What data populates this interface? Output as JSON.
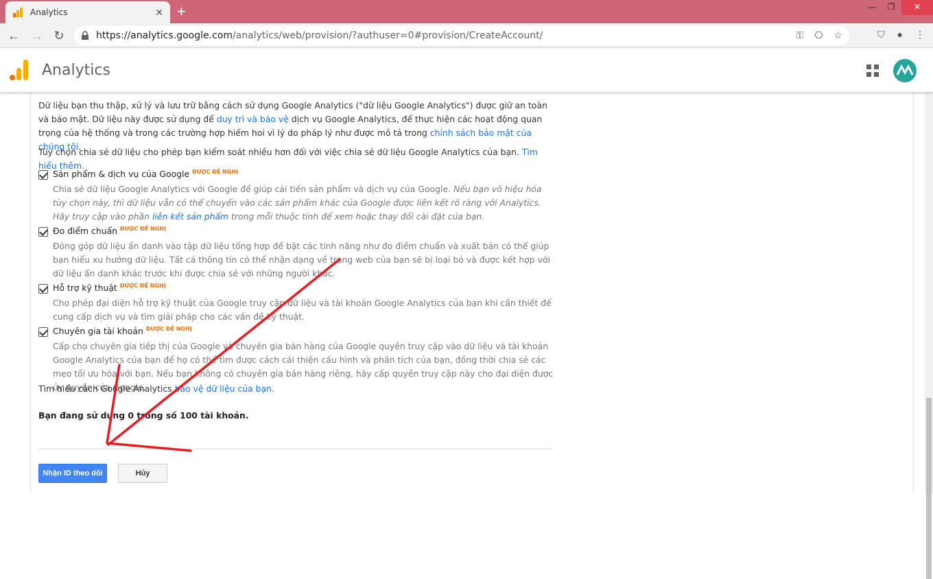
{
  "browser": {
    "tab_title": "Analytics",
    "url_host": "https://analytics.google.com",
    "url_path": "/analytics/web/provision/?authuser=0#provision/CreateAccount/"
  },
  "app": {
    "title": "Analytics",
    "accent_color": "#f9ab00"
  },
  "intro": {
    "p1_a": "Dữ liệu bạn thu thập, xử lý và lưu trữ bằng cách sử dụng Google Analytics (\"dữ liệu Google Analytics\") được giữ an toàn và bảo mật. Dữ liệu này được sử dụng để ",
    "p1_link1": "duy trì và bảo vệ",
    "p1_b": " dịch vụ Google Analytics, để thực hiện các hoạt động quan trọng của hệ thống và trong các trường hợp hiếm hoi vì lý do pháp lý như được mô tả trong ",
    "p1_link2": "chính sách bảo mật của chúng tôi",
    "p1_c": ".",
    "p2_a": "Tùy chọn chia sẻ dữ liệu cho phép bạn kiểm soát nhiều hơn đối với việc chia sẻ dữ liệu Google Analytics của bạn. ",
    "p2_link": "Tìm hiểu thêm."
  },
  "options": [
    {
      "label": "Sản phẩm & dịch vụ của Google",
      "badge": "ĐƯỢC ĐỀ NGHỊ",
      "desc_a": "Chia sẻ dữ liệu Google Analytics với Google để giúp cải tiến sản phẩm và dịch vụ của Google. ",
      "desc_i1": "Nếu bạn vô hiệu hóa tùy chọn này, thì dữ liệu vẫn có thể chuyển vào các sản phẩm khác của Google được liên kết rõ ràng với Analytics. Hãy truy cập vào phần ",
      "desc_link": "liên kết sản phẩm",
      "desc_i2": " trong mỗi thuộc tính để xem hoặc thay đổi cài đặt của bạn."
    },
    {
      "label": "Đo điểm chuẩn",
      "badge": "ĐƯỢC ĐỀ NGHỊ",
      "desc_a": "Đóng góp dữ liệu ẩn danh vào tập dữ liệu tổng hợp để bật các tính năng như đo điểm chuẩn và xuất bản có thể giúp bạn hiểu xu hướng dữ liệu. Tất cả thông tin có thể nhận dạng về trang web của bạn sẽ bị loại bỏ và được kết hợp với dữ liệu ẩn danh khác trước khi được chia sẻ với những người khác."
    },
    {
      "label": "Hỗ trợ kỹ thuật",
      "badge": "ĐƯỢC ĐỀ NGHỊ",
      "desc_a": "Cho phép đại diện hỗ trợ kỹ thuật của Google truy cập dữ liệu và tài khoản Google Analytics của bạn khi cần thiết để cung cấp dịch vụ và tìm giải pháp cho các vấn đề kỹ thuật."
    },
    {
      "label": "Chuyên gia tài khoản",
      "badge": "ĐƯỢC ĐỀ NGHỊ",
      "desc_a": "Cấp cho chuyên gia tiếp thị của Google và chuyên gia bán hàng của Google quyền truy cập vào dữ liệu và tài khoản Google Analytics của bạn để họ có thể tìm được cách cải thiện cấu hình và phân tích của bạn, đồng thời chia sẻ các mẹo tối ưu hóa với bạn. Nếu bạn không có chuyên gia bán hàng riêng, hãy cấp quyền truy cập này cho đại diện được ủy quyền của Google."
    }
  ],
  "protect": {
    "text": "Tìm hiểu cách Google Analytics ",
    "link": "bảo vệ dữ liệu của bạn."
  },
  "usage": "Bạn đang sử dụng 0 trong số 100 tài khoản.",
  "buttons": {
    "primary": "Nhận ID theo dõi",
    "secondary": "Hủy"
  }
}
